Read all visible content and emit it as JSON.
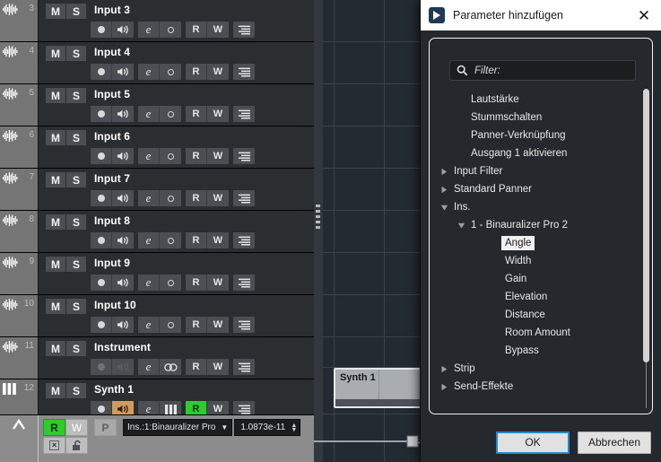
{
  "tracklist": {
    "tracks": [
      {
        "num": "3",
        "name": "Input 3",
        "icon": "waveform-icon",
        "mute": "M",
        "solo": "S",
        "controls": [
          {
            "name": "record-arm-button",
            "glyph": "dot",
            "state": "normal"
          },
          {
            "name": "monitor-button",
            "glyph": "speaker",
            "state": "normal"
          },
          {
            "name": "edit-button",
            "glyph": "e",
            "state": "normal"
          },
          {
            "name": "input-button",
            "glyph": "ring",
            "state": "normal"
          },
          {
            "name": "read-automation-button",
            "glyph": "R",
            "state": "normal"
          },
          {
            "name": "write-automation-button",
            "glyph": "W",
            "state": "normal"
          },
          {
            "name": "track-menu-button",
            "glyph": "lines",
            "state": "normal"
          }
        ]
      },
      {
        "num": "4",
        "name": "Input 4",
        "icon": "waveform-icon",
        "mute": "M",
        "solo": "S",
        "controls": [
          {
            "name": "record-arm-button",
            "glyph": "dot",
            "state": "normal"
          },
          {
            "name": "monitor-button",
            "glyph": "speaker",
            "state": "normal"
          },
          {
            "name": "edit-button",
            "glyph": "e",
            "state": "normal"
          },
          {
            "name": "input-button",
            "glyph": "ring",
            "state": "normal"
          },
          {
            "name": "read-automation-button",
            "glyph": "R",
            "state": "normal"
          },
          {
            "name": "write-automation-button",
            "glyph": "W",
            "state": "normal"
          },
          {
            "name": "track-menu-button",
            "glyph": "lines",
            "state": "normal"
          }
        ]
      },
      {
        "num": "5",
        "name": "Input 5",
        "icon": "waveform-icon",
        "mute": "M",
        "solo": "S",
        "controls": [
          {
            "name": "record-arm-button",
            "glyph": "dot",
            "state": "normal"
          },
          {
            "name": "monitor-button",
            "glyph": "speaker",
            "state": "normal"
          },
          {
            "name": "edit-button",
            "glyph": "e",
            "state": "normal"
          },
          {
            "name": "input-button",
            "glyph": "ring",
            "state": "normal"
          },
          {
            "name": "read-automation-button",
            "glyph": "R",
            "state": "normal"
          },
          {
            "name": "write-automation-button",
            "glyph": "W",
            "state": "normal"
          },
          {
            "name": "track-menu-button",
            "glyph": "lines",
            "state": "normal"
          }
        ]
      },
      {
        "num": "6",
        "name": "Input 6",
        "icon": "waveform-icon",
        "mute": "M",
        "solo": "S",
        "controls": [
          {
            "name": "record-arm-button",
            "glyph": "dot",
            "state": "normal"
          },
          {
            "name": "monitor-button",
            "glyph": "speaker",
            "state": "normal"
          },
          {
            "name": "edit-button",
            "glyph": "e",
            "state": "normal"
          },
          {
            "name": "input-button",
            "glyph": "ring",
            "state": "normal"
          },
          {
            "name": "read-automation-button",
            "glyph": "R",
            "state": "normal"
          },
          {
            "name": "write-automation-button",
            "glyph": "W",
            "state": "normal"
          },
          {
            "name": "track-menu-button",
            "glyph": "lines",
            "state": "normal"
          }
        ]
      },
      {
        "num": "7",
        "name": "Input 7",
        "icon": "waveform-icon",
        "mute": "M",
        "solo": "S",
        "controls": [
          {
            "name": "record-arm-button",
            "glyph": "dot",
            "state": "normal"
          },
          {
            "name": "monitor-button",
            "glyph": "speaker",
            "state": "normal"
          },
          {
            "name": "edit-button",
            "glyph": "e",
            "state": "normal"
          },
          {
            "name": "input-button",
            "glyph": "ring",
            "state": "normal"
          },
          {
            "name": "read-automation-button",
            "glyph": "R",
            "state": "normal"
          },
          {
            "name": "write-automation-button",
            "glyph": "W",
            "state": "normal"
          },
          {
            "name": "track-menu-button",
            "glyph": "lines",
            "state": "normal"
          }
        ]
      },
      {
        "num": "8",
        "name": "Input 8",
        "icon": "waveform-icon",
        "mute": "M",
        "solo": "S",
        "controls": [
          {
            "name": "record-arm-button",
            "glyph": "dot",
            "state": "normal"
          },
          {
            "name": "monitor-button",
            "glyph": "speaker",
            "state": "normal"
          },
          {
            "name": "edit-button",
            "glyph": "e",
            "state": "normal"
          },
          {
            "name": "input-button",
            "glyph": "ring",
            "state": "normal"
          },
          {
            "name": "read-automation-button",
            "glyph": "R",
            "state": "normal"
          },
          {
            "name": "write-automation-button",
            "glyph": "W",
            "state": "normal"
          },
          {
            "name": "track-menu-button",
            "glyph": "lines",
            "state": "normal"
          }
        ]
      },
      {
        "num": "9",
        "name": "Input 9",
        "icon": "waveform-icon",
        "mute": "M",
        "solo": "S",
        "controls": [
          {
            "name": "record-arm-button",
            "glyph": "dot",
            "state": "normal"
          },
          {
            "name": "monitor-button",
            "glyph": "speaker",
            "state": "normal"
          },
          {
            "name": "edit-button",
            "glyph": "e",
            "state": "normal"
          },
          {
            "name": "input-button",
            "glyph": "ring",
            "state": "normal"
          },
          {
            "name": "read-automation-button",
            "glyph": "R",
            "state": "normal"
          },
          {
            "name": "write-automation-button",
            "glyph": "W",
            "state": "normal"
          },
          {
            "name": "track-menu-button",
            "glyph": "lines",
            "state": "normal"
          }
        ]
      },
      {
        "num": "10",
        "name": "Input 10",
        "icon": "waveform-icon",
        "mute": "M",
        "solo": "S",
        "controls": [
          {
            "name": "record-arm-button",
            "glyph": "dot",
            "state": "normal"
          },
          {
            "name": "monitor-button",
            "glyph": "speaker",
            "state": "normal"
          },
          {
            "name": "edit-button",
            "glyph": "e",
            "state": "normal"
          },
          {
            "name": "input-button",
            "glyph": "ring",
            "state": "normal"
          },
          {
            "name": "read-automation-button",
            "glyph": "R",
            "state": "normal"
          },
          {
            "name": "write-automation-button",
            "glyph": "W",
            "state": "normal"
          },
          {
            "name": "track-menu-button",
            "glyph": "lines",
            "state": "normal"
          }
        ]
      },
      {
        "num": "11",
        "name": "Instrument",
        "icon": "waveform-icon",
        "mute": "M",
        "solo": "S",
        "controls": [
          {
            "name": "record-arm-button",
            "glyph": "dot",
            "state": "dim"
          },
          {
            "name": "monitor-button",
            "glyph": "speaker",
            "state": "dim"
          },
          {
            "name": "edit-button",
            "glyph": "e",
            "state": "normal"
          },
          {
            "name": "link-button",
            "glyph": "chain",
            "state": "normal"
          },
          {
            "name": "read-automation-button",
            "glyph": "R",
            "state": "normal"
          },
          {
            "name": "write-automation-button",
            "glyph": "W",
            "state": "normal"
          },
          {
            "name": "track-menu-button",
            "glyph": "lines",
            "state": "normal"
          }
        ]
      },
      {
        "num": "12",
        "name": "Synth 1",
        "icon": "piano-icon",
        "mute": "M",
        "solo": "S",
        "controls": [
          {
            "name": "record-arm-button",
            "glyph": "dot",
            "state": "normal"
          },
          {
            "name": "monitor-button",
            "glyph": "speaker",
            "state": "orange"
          },
          {
            "name": "edit-button",
            "glyph": "e",
            "state": "normal"
          },
          {
            "name": "instrument-button",
            "glyph": "piano",
            "state": "normal"
          },
          {
            "name": "read-automation-button",
            "glyph": "R",
            "state": "green"
          },
          {
            "name": "write-automation-button",
            "glyph": "W",
            "state": "normal"
          },
          {
            "name": "track-menu-button",
            "glyph": "lines",
            "state": "normal"
          }
        ]
      }
    ]
  },
  "automation_lane": {
    "read_label": "R",
    "write_label": "W",
    "protect_label": "P",
    "remove_label": "×",
    "parameter_selected": "Ins.:1:Binauralizer Pro",
    "parameter_value": "1.0873e-11"
  },
  "arrangement": {
    "clip_name": "Synth 1"
  },
  "dialog": {
    "title": "Parameter hinzufügen",
    "close_label": "✕",
    "filter_placeholder": "Filter:",
    "filter_value": "",
    "ok_label": "OK",
    "cancel_label": "Abbrechen",
    "accent_color": "#1d8ad2",
    "selection_color": "#f0f0f0",
    "tree": [
      {
        "label": "Lautstärke",
        "depth": 1,
        "arrow": "none",
        "selected": false
      },
      {
        "label": "Stummschalten",
        "depth": 1,
        "arrow": "none",
        "selected": false
      },
      {
        "label": "Panner-Verknüpfung",
        "depth": 1,
        "arrow": "none",
        "selected": false
      },
      {
        "label": "Ausgang 1 aktivieren",
        "depth": 1,
        "arrow": "none",
        "selected": false
      },
      {
        "label": "Input Filter",
        "depth": 0,
        "arrow": "collapsed",
        "selected": false
      },
      {
        "label": "Standard Panner",
        "depth": 0,
        "arrow": "collapsed",
        "selected": false
      },
      {
        "label": "Ins.",
        "depth": 0,
        "arrow": "expanded",
        "selected": false
      },
      {
        "label": "1 - Binauralizer Pro 2",
        "depth": 1,
        "arrow": "expanded",
        "selected": false
      },
      {
        "label": "Angle",
        "depth": 3,
        "arrow": "none",
        "selected": true
      },
      {
        "label": "Width",
        "depth": 3,
        "arrow": "none",
        "selected": false
      },
      {
        "label": "Gain",
        "depth": 3,
        "arrow": "none",
        "selected": false
      },
      {
        "label": "Elevation",
        "depth": 3,
        "arrow": "none",
        "selected": false
      },
      {
        "label": "Distance",
        "depth": 3,
        "arrow": "none",
        "selected": false
      },
      {
        "label": "Room Amount",
        "depth": 3,
        "arrow": "none",
        "selected": false
      },
      {
        "label": "Bypass",
        "depth": 3,
        "arrow": "none",
        "selected": false
      },
      {
        "label": "Strip",
        "depth": 0,
        "arrow": "collapsed",
        "selected": false
      },
      {
        "label": "Send-Effekte",
        "depth": 0,
        "arrow": "collapsed",
        "selected": false
      }
    ]
  }
}
